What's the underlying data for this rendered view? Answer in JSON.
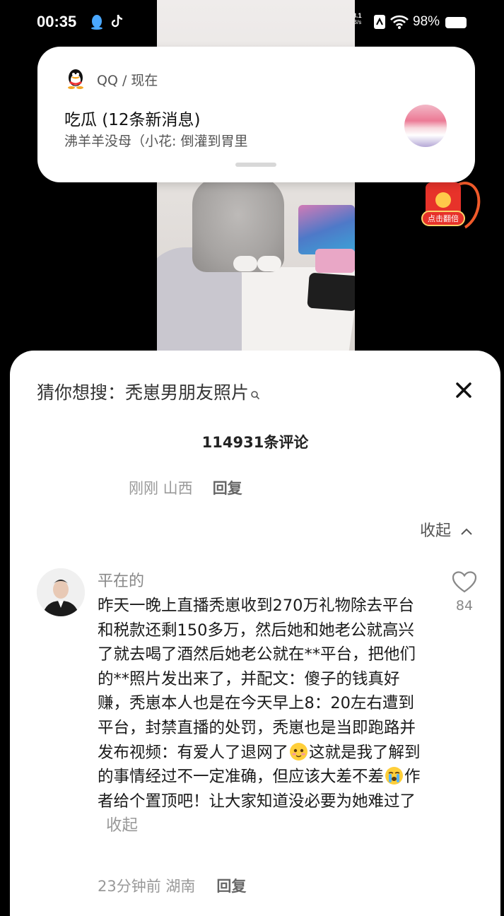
{
  "status_bar": {
    "time": "00:35",
    "net_speed_value": "38.1",
    "net_speed_unit": "KB/s",
    "battery": "98%"
  },
  "notification": {
    "app": "QQ / 现在",
    "title": "吃瓜 (12条新消息)",
    "body": "沸羊羊没母（小花: 倒灌到胃里"
  },
  "red_packet": {
    "label": "点击翻倍"
  },
  "comments": {
    "search_prefix": "猜你想搜：",
    "search_term": "秃崽男朋友照片",
    "count": "114931条评论",
    "prev_reply_meta": "刚刚 山西",
    "prev_reply_button": "回复",
    "collapse": "收起",
    "items": [
      {
        "user": "平在的",
        "text_part1": "昨天一晚上直播秃崽收到270万礼物除去平台和税款还剩150多万，然后她和她老公就高兴了就去喝了酒然后她老公就在**平台，把他们的**照片发出来了，并配文：傻子的钱真好赚，秃崽本人也是在今天早上8：20左右遭到平台，封禁直播的处罚，秃崽也是当即跑路并发布视频：有爱人了退网了",
        "text_part2": "这就是我了解到的事情经过不一定准确，但应该大差不差",
        "text_part3": "作者给个置顶吧！让大家知道没必要为她难过了",
        "more": "收起",
        "likes": "84",
        "meta": "23分钟前 湖南",
        "reply_button": "回复",
        "emoji1": "blush-emoji",
        "emoji2": "crying-emoji"
      }
    ]
  },
  "icons": {
    "status": [
      "qq-penguin-icon",
      "tiktok-icon",
      "microphone-icon",
      "nfc-icon",
      "wifi-icon",
      "battery-icon"
    ],
    "sheet": [
      "search-icon",
      "close-icon",
      "chevron-up-icon",
      "heart-icon"
    ]
  }
}
